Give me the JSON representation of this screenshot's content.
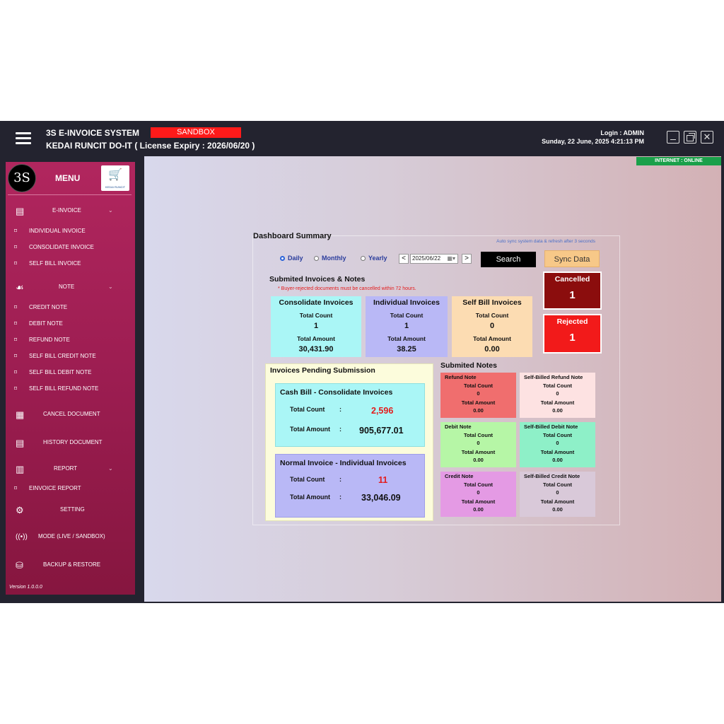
{
  "titlebar": {
    "system_name": "3S E-INVOICE SYSTEM",
    "environment_badge": "SANDBOX",
    "shop_line": "KEDAI RUNCIT DO-IT ( License Expiry : 2026/06/20 )",
    "login": "Login : ADMIN",
    "datetime": "Sunday, 22 June, 2025 4:21:13 PM",
    "internet_status": "INTERNET : ONLINE"
  },
  "sidebar": {
    "logo_text": "3S",
    "menu_title": "MENU",
    "shop_logo_text": "KEDAI RUNCIT",
    "sections": {
      "einvoice": "E-INVOICE",
      "note": "NOTE",
      "report": "REPORT"
    },
    "einvoice_items": [
      "INDIVIDUAL INVOICE",
      "CONSOLIDATE INVOICE",
      "SELF BILL INVOICE"
    ],
    "note_items": [
      "CREDIT NOTE",
      "DEBIT NOTE",
      "REFUND NOTE",
      "SELF BILL CREDIT NOTE",
      "SELF BILL DEBIT NOTE",
      "SELF BILL REFUND NOTE"
    ],
    "cancel_document": "CANCEL DOCUMENT",
    "history_document": "HISTORY DOCUMENT",
    "report_items": [
      "EINVOICE REPORT"
    ],
    "setting": "SETTING",
    "mode": "MODE (LIVE / SANDBOX)",
    "backup": "BACKUP & RESTORE",
    "version": "Version 1.0.0.0"
  },
  "dashboard": {
    "title": "Dashboard Summary",
    "auto_sync_note": "Auto sync system data & refresh after 3 seconds",
    "period_options": [
      "Daily",
      "Monthly",
      "Yearly"
    ],
    "selected_period": "Daily",
    "date": "2025/06/22",
    "prev_label": "<",
    "next_label": ">",
    "search_label": "Search",
    "sync_label": "Sync Data",
    "submitted_title": "Submited Invoices & Notes",
    "warning": "* Buyer-rejected documents must be cancelled within 72 hours.",
    "count_label": "Total Count",
    "amount_label": "Total Amount",
    "invoice_cards": [
      {
        "title": "Consolidate Invoices",
        "count": "1",
        "amount": "30,431.90",
        "color": "#aaf6f6"
      },
      {
        "title": "Individual Invoices",
        "count": "1",
        "amount": "38.25",
        "color": "#b9b8f6"
      },
      {
        "title": "Self Bill Invoices",
        "count": "0",
        "amount": "0.00",
        "color": "#fcdcb2"
      }
    ],
    "cancelled": {
      "label": "Cancelled",
      "value": "1",
      "color": "#8b0d0d"
    },
    "rejected": {
      "label": "Rejected",
      "value": "1",
      "color": "#f21a1a"
    },
    "pending": {
      "title": "Invoices Pending Submission",
      "cash_bill": {
        "title": "Cash Bill - Consolidate Invoices",
        "count": "2,596",
        "amount": "905,677.01"
      },
      "normal": {
        "title": "Normal Invoice - Individual Invoices",
        "count": "11",
        "amount": "33,046.09"
      },
      "colon": ":"
    },
    "notes_title": "Submited Notes",
    "notes": [
      {
        "title": "Refund Note",
        "count": "0",
        "amount": "0.00",
        "color": "#f06e6e"
      },
      {
        "title": "Self-Billed Refund Note",
        "count": "0",
        "amount": "0.00",
        "color": "#fde2e2"
      },
      {
        "title": "Debit Note",
        "count": "0",
        "amount": "0.00",
        "color": "#b6f6a6"
      },
      {
        "title": "Self-Billed Debit Note",
        "count": "0",
        "amount": "0.00",
        "color": "#8ef0c8"
      },
      {
        "title": "Credit Note",
        "count": "0",
        "amount": "0.00",
        "color": "#e49ae4"
      },
      {
        "title": "Self-Billed Credit Note",
        "count": "0",
        "amount": "0.00",
        "color": "#d9c9d9"
      }
    ]
  }
}
